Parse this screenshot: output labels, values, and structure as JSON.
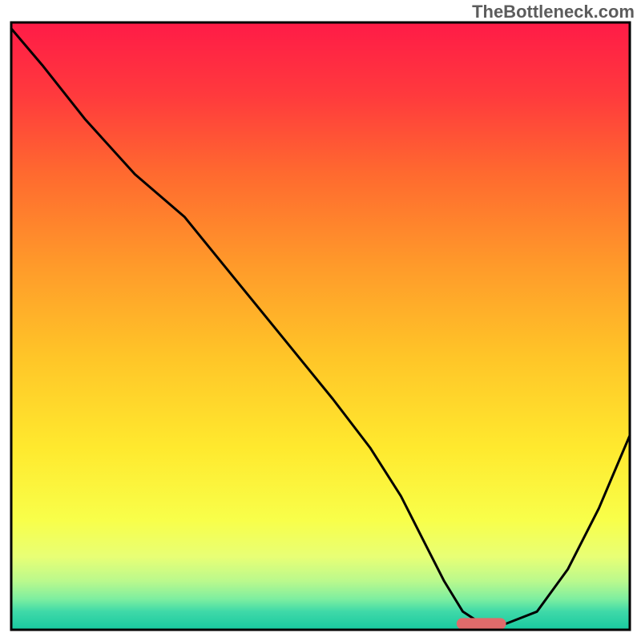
{
  "watermark": "TheBottleneck.com",
  "chart_data": {
    "type": "line",
    "title": "",
    "xlabel": "",
    "ylabel": "",
    "xlim": [
      0,
      100
    ],
    "ylim": [
      0,
      100
    ],
    "grid": false,
    "legend": false,
    "series": [
      {
        "name": "bottleneck-curve",
        "x": [
          0,
          5,
          12,
          20,
          28,
          36,
          44,
          52,
          58,
          63,
          67,
          70,
          73,
          76,
          80,
          85,
          90,
          95,
          100
        ],
        "y": [
          99,
          93,
          84,
          75,
          68,
          58,
          48,
          38,
          30,
          22,
          14,
          8,
          3,
          1,
          1,
          3,
          10,
          20,
          32
        ]
      }
    ],
    "optimal_marker": {
      "x_start": 72,
      "x_end": 80,
      "y": 1
    },
    "background": {
      "type": "vertical-gradient",
      "stops": [
        {
          "offset": 0.0,
          "color": "#ff1b47"
        },
        {
          "offset": 0.12,
          "color": "#ff3a3d"
        },
        {
          "offset": 0.25,
          "color": "#ff6a2f"
        },
        {
          "offset": 0.4,
          "color": "#ff9a2a"
        },
        {
          "offset": 0.55,
          "color": "#ffc528"
        },
        {
          "offset": 0.7,
          "color": "#ffe92e"
        },
        {
          "offset": 0.82,
          "color": "#f8ff4a"
        },
        {
          "offset": 0.88,
          "color": "#e8ff75"
        },
        {
          "offset": 0.92,
          "color": "#baf98d"
        },
        {
          "offset": 0.95,
          "color": "#7ceea0"
        },
        {
          "offset": 0.97,
          "color": "#3fd9a8"
        },
        {
          "offset": 1.0,
          "color": "#18c9a0"
        }
      ]
    }
  }
}
